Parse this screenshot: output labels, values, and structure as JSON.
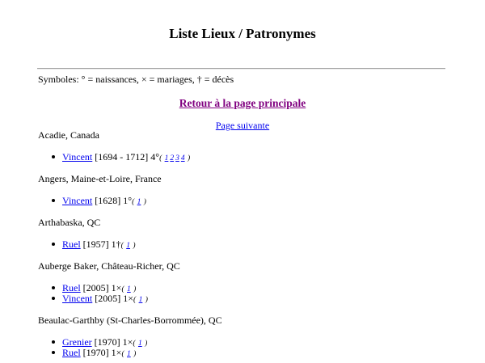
{
  "title": "Liste Lieux / Patronymes",
  "symbols": "Symboles: ° = naissances, × = mariages, † = décès",
  "back_link": "Retour à la page principale",
  "next_link": "Page suivante",
  "places": [
    {
      "name": "Acadie, Canada",
      "entries": [
        {
          "surname": "Vincent",
          "detail": " [1694 - 1712] 4°",
          "refs": [
            "1",
            "2",
            "3",
            "4"
          ]
        }
      ]
    },
    {
      "name": "Angers, Maine-et-Loire, France",
      "entries": [
        {
          "surname": "Vincent",
          "detail": " [1628] 1°",
          "refs": [
            "1"
          ]
        }
      ]
    },
    {
      "name": "Arthabaska, QC",
      "entries": [
        {
          "surname": "Ruel",
          "detail": " [1957] 1†",
          "refs": [
            "1"
          ]
        }
      ]
    },
    {
      "name": "Auberge Baker, Château-Richer, QC",
      "entries": [
        {
          "surname": "Ruel",
          "detail": " [2005] 1×",
          "refs": [
            "1"
          ]
        },
        {
          "surname": "Vincent",
          "detail": " [2005] 1×",
          "refs": [
            "1"
          ]
        }
      ]
    },
    {
      "name": "Beaulac-Garthby (St-Charles-Borrommée), QC",
      "entries": [
        {
          "surname": "Grenier",
          "detail": " [1970] 1×",
          "refs": [
            "1"
          ]
        },
        {
          "surname": "Ruel",
          "detail": " [1970] 1×",
          "refs": [
            "1"
          ]
        }
      ]
    }
  ]
}
